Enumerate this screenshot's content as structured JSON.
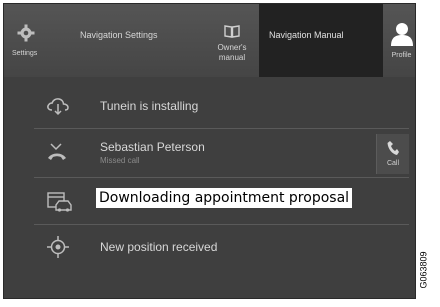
{
  "topbar": {
    "settings": {
      "label": "Settings",
      "icon": "gear-icon"
    },
    "nav_settings": {
      "label": "Navigation Settings"
    },
    "owners_manual": {
      "label": "Owner's manual",
      "icon": "book-icon"
    },
    "nav_manual": {
      "label": "Navigation Manual",
      "active": true
    },
    "profile": {
      "label": "Profile",
      "icon": "person-icon"
    }
  },
  "list": {
    "items": [
      {
        "title": "Tunein is installing",
        "icon": "cloud-download-icon"
      },
      {
        "title": "Sebastian Peterson",
        "subtitle": "Missed call",
        "icon": "missed-call-icon",
        "action": {
          "label": "Call",
          "icon": "phone-icon"
        }
      },
      {
        "title": "Downloading appointment proposal",
        "icon": "calendar-car-icon",
        "highlighted": true
      },
      {
        "title": "New position received",
        "icon": "position-icon"
      }
    ]
  },
  "figure_code": "G063809",
  "colors": {
    "background": "#3f3f3f",
    "topbar": "#4a4a4a",
    "active_tab": "#222222",
    "text": "#d8d8d8",
    "toast_background": "#ffffff"
  }
}
